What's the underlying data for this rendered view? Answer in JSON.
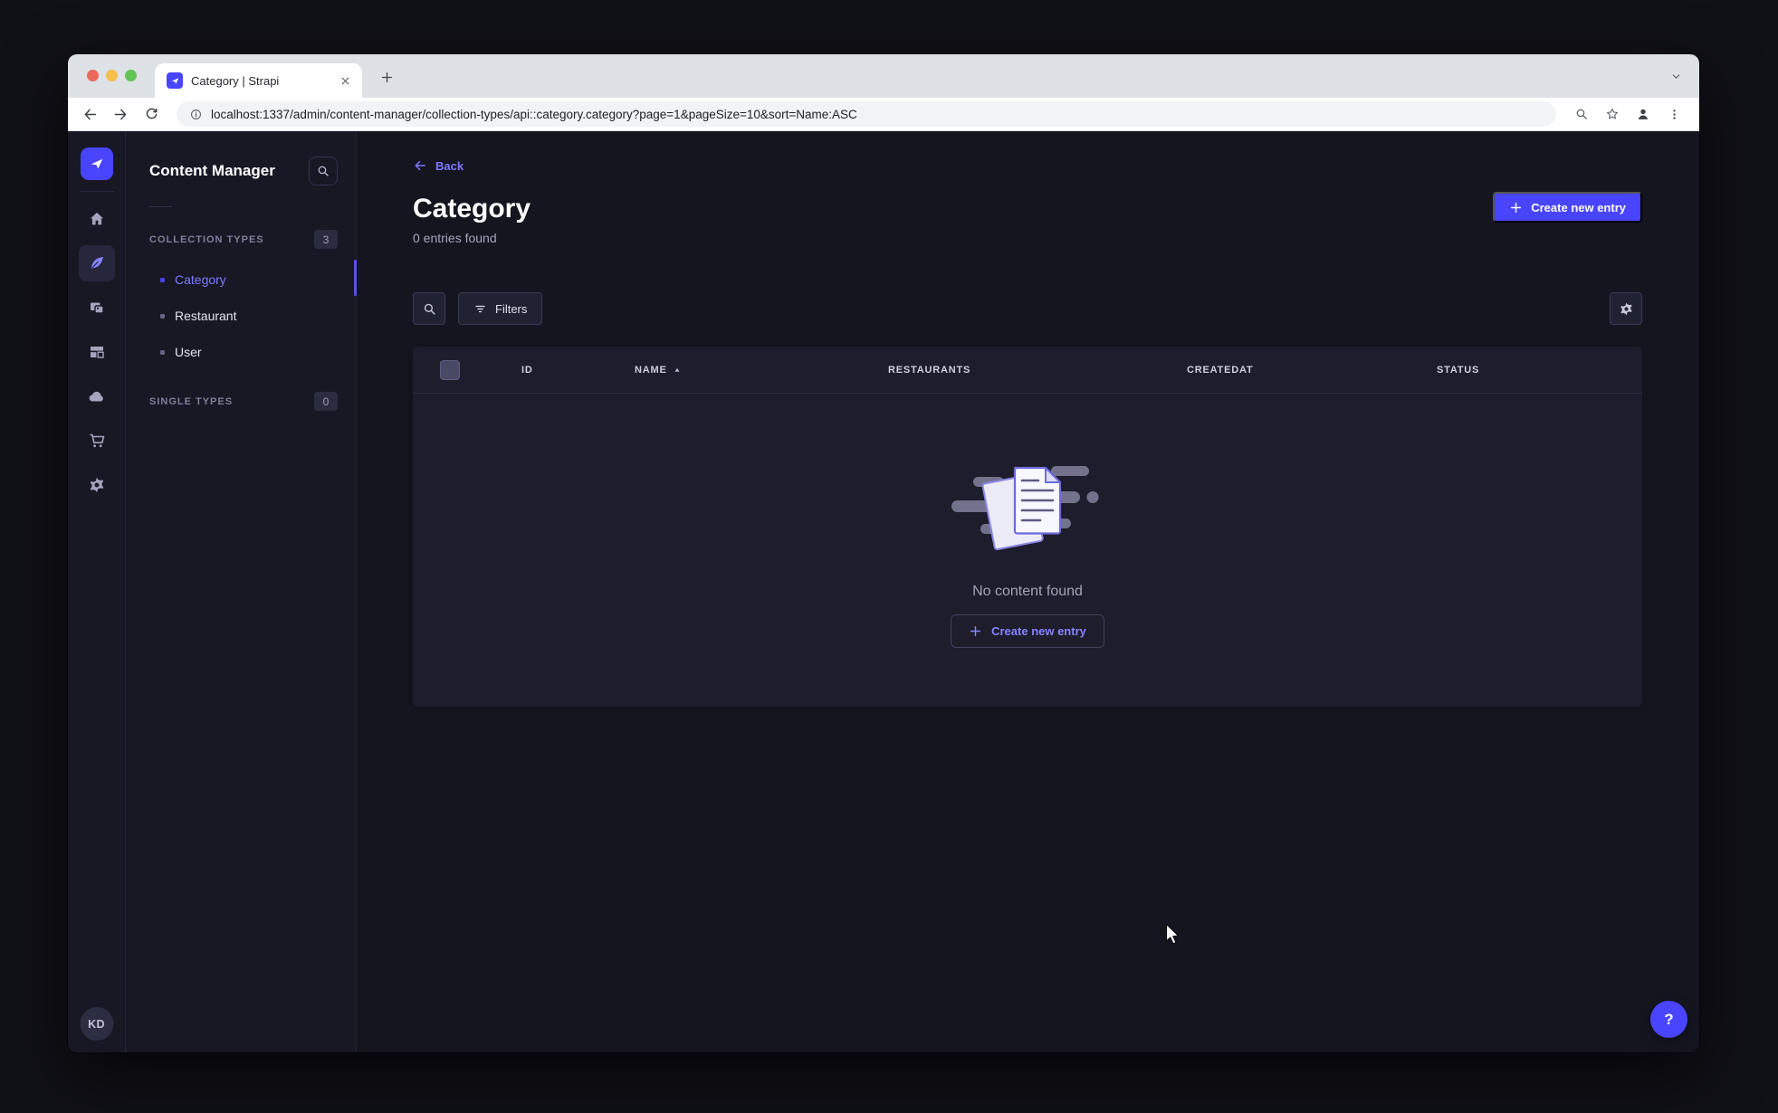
{
  "browser": {
    "tab": {
      "title": "Category | Strapi"
    },
    "address": {
      "url": "localhost:1337/admin/content-manager/collection-types/api::category.category?page=1&pageSize=10&sort=Name:ASC"
    }
  },
  "rail": {
    "user_initials": "KD"
  },
  "subnav": {
    "title": "Content Manager",
    "collection_types": {
      "label": "COLLECTION TYPES",
      "badge": "3",
      "items": [
        {
          "label": "Category",
          "active": true
        },
        {
          "label": "Restaurant",
          "active": false
        },
        {
          "label": "User",
          "active": false
        }
      ]
    },
    "single_types": {
      "label": "SINGLE TYPES",
      "badge": "0"
    }
  },
  "page": {
    "back_label": "Back",
    "title": "Category",
    "subtitle": "0 entries found",
    "create_button": "Create new entry",
    "filters_button": "Filters",
    "help_label": "?"
  },
  "table": {
    "columns": [
      {
        "label": "ID"
      },
      {
        "label": "NAME",
        "sorted": "asc"
      },
      {
        "label": "RESTAURANTS"
      },
      {
        "label": "CREATEDAT"
      },
      {
        "label": "STATUS"
      }
    ],
    "empty_message": "No content found",
    "empty_create_button": "Create new entry"
  },
  "colors": {
    "primary": "#4945ff",
    "primary_light": "#7b79ff",
    "chrome_tabbar": "#dee1e6",
    "app_bg": "#151520",
    "panel_bg": "#181825",
    "card_bg": "#1d1d2b"
  }
}
